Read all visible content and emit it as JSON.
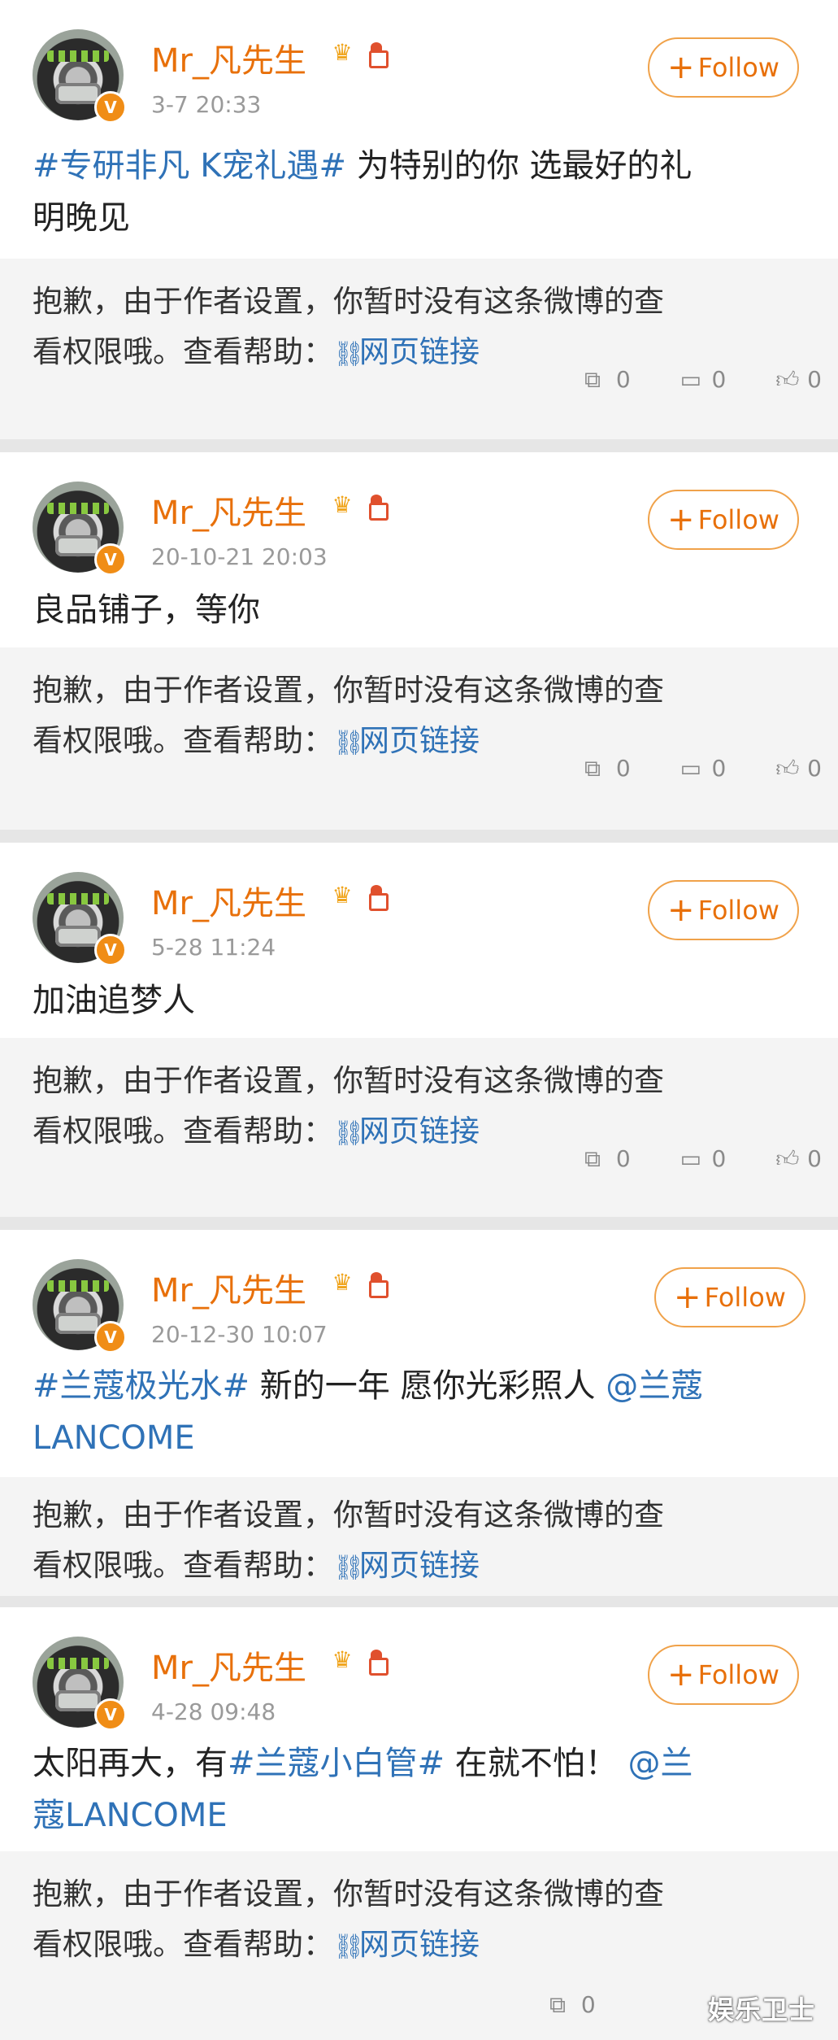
{
  "posts": [
    {
      "username": "Mr_凡先生",
      "time": "3-7 20:33",
      "follow_label": "Follow",
      "content_tag": "#专研非凡 K宠礼遇#",
      "content_line1": " 为特别的你 选最好的礼",
      "content_line2": "明晚见",
      "notice_line1": "抱歉，由于作者设置，你暂时没有这条微博的查",
      "notice_line2_prefix": "看权限哦。查看帮助：",
      "link_label": "网页链接",
      "repost_count": "0",
      "comment_count": "0",
      "like_count": "0"
    },
    {
      "username": "Mr_凡先生",
      "time": "20-10-21 20:03",
      "follow_label": "Follow",
      "content_line1": "良品铺子，等你",
      "notice_line1": "抱歉，由于作者设置，你暂时没有这条微博的查",
      "notice_line2_prefix": "看权限哦。查看帮助：",
      "link_label": "网页链接",
      "repost_count": "0",
      "comment_count": "0",
      "like_count": "0"
    },
    {
      "username": "Mr_凡先生",
      "time": "5-28 11:24",
      "follow_label": "Follow",
      "content_line1": "加油追梦人",
      "notice_line1": "抱歉，由于作者设置，你暂时没有这条微博的查",
      "notice_line2_prefix": "看权限哦。查看帮助：",
      "link_label": "网页链接",
      "repost_count": "0",
      "comment_count": "0",
      "like_count": "0"
    },
    {
      "username": "Mr_凡先生",
      "time": "20-12-30 10:07",
      "follow_label": "Follow",
      "content_tag": "#兰蔻极光水#",
      "content_line1": " 新的一年 愿你光彩照人 ",
      "mention1": "@兰蔻",
      "mention2": "LANCOME",
      "notice_line1": "抱歉，由于作者设置，你暂时没有这条微博的查",
      "notice_line2_prefix": "看权限哦。查看帮助：",
      "link_label": "网页链接"
    },
    {
      "username": "Mr_凡先生",
      "time": "4-28 09:48",
      "follow_label": "Follow",
      "content_prefix": "太阳再大，有",
      "content_tag": "#兰蔻小白管#",
      "content_line1": " 在就不怕！ ",
      "mention1": "@兰",
      "mention2": "蔻LANCOME",
      "notice_line1": "抱歉，由于作者设置，你暂时没有这条微博的查",
      "notice_line2_prefix": "看权限哦。查看帮助：",
      "link_label": "网页链接",
      "repost_count": "0"
    }
  ],
  "watermark": "娱乐卫士",
  "icons": {
    "crown": "crown-icon",
    "gift": "gift-icon",
    "link": "link-icon",
    "repost": "repost-icon",
    "comment": "comment-icon",
    "like": "like-icon"
  },
  "colors": {
    "username": "#e8700a",
    "follow_border": "#f0a24a",
    "link": "#2f72b7",
    "verified_badge": "#f08d16"
  }
}
